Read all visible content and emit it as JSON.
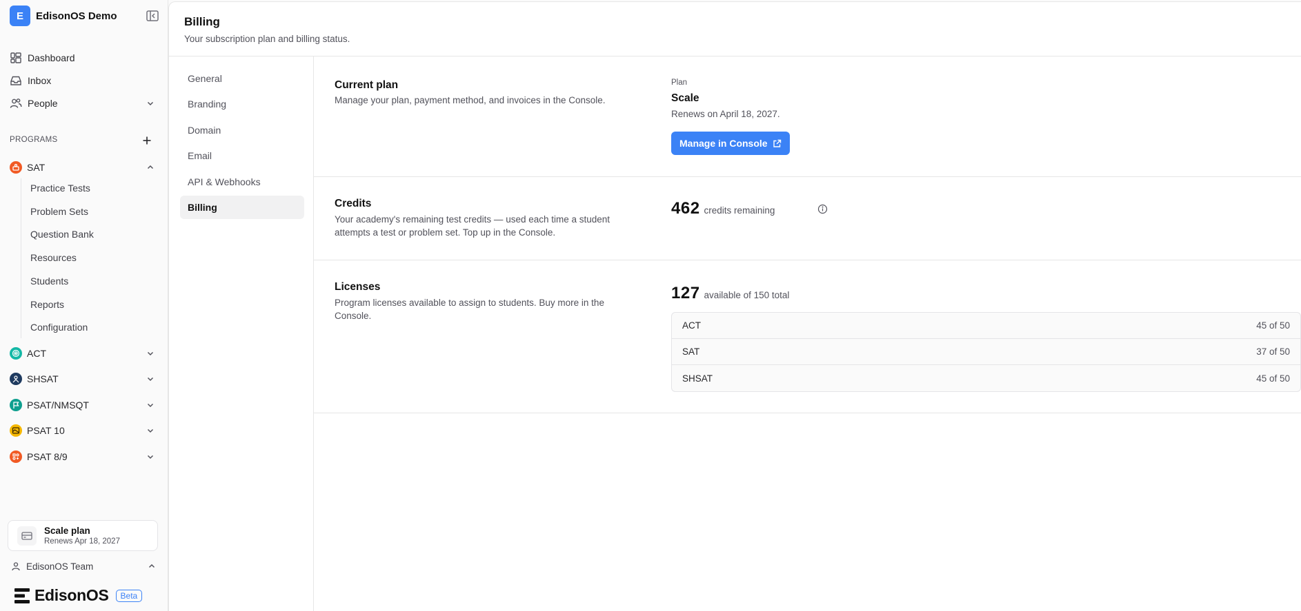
{
  "org": {
    "initial": "E",
    "name": "EdisonOS Demo"
  },
  "nav": {
    "dashboard": "Dashboard",
    "inbox": "Inbox",
    "people": "People"
  },
  "programs_label": "PROGRAMS",
  "programs": {
    "sat": "SAT",
    "sat_items": [
      "Practice Tests",
      "Problem Sets",
      "Question Bank",
      "Resources",
      "Students",
      "Reports",
      "Configuration"
    ],
    "act": "ACT",
    "shsat": "SHSAT",
    "psat_nmsqt": "PSAT/NMSQT",
    "psat10": "PSAT 10",
    "psat89": "PSAT 8/9"
  },
  "plan_card": {
    "title": "Scale plan",
    "subtitle": "Renews Apr 18, 2027"
  },
  "team": "EdisonOS Team",
  "brand": {
    "name": "EdisonOS",
    "badge": "Beta"
  },
  "header": {
    "title": "Billing",
    "subtitle": "Your subscription plan and billing status."
  },
  "settings_nav": [
    "General",
    "Branding",
    "Domain",
    "Email",
    "API & Webhooks",
    "Billing"
  ],
  "current_plan": {
    "title": "Current plan",
    "desc": "Manage your plan, payment method, and invoices in the Console.",
    "label": "Plan",
    "name": "Scale",
    "renews": "Renews on April 18, 2027.",
    "button": "Manage in Console"
  },
  "credits": {
    "title": "Credits",
    "desc": "Your academy's remaining test credits — used each time a student attempts a test or problem set. Top up in the Console.",
    "count": "462",
    "suffix": "credits remaining"
  },
  "licenses": {
    "title": "Licenses",
    "desc": "Program licenses available to assign to students. Buy more in the Console.",
    "count": "127",
    "suffix": "available of 150 total",
    "rows": [
      {
        "program": "ACT",
        "usage": "45 of 50"
      },
      {
        "program": "SAT",
        "usage": "37 of 50"
      },
      {
        "program": "SHSAT",
        "usage": "45 of 50"
      }
    ]
  },
  "colors": {
    "accent": "#3b82f6",
    "sat": "#f15a24",
    "act": "#14b8a6",
    "shsat": "#1e3a5f",
    "psat_nmsqt": "#0f9f8f",
    "psat10": "#f5b700",
    "psat89": "#f15a24"
  },
  "icons": [
    "sidebar-collapse-icon",
    "dashboard-icon",
    "inbox-icon",
    "people-icon",
    "chevron-down-icon",
    "chevron-up-icon",
    "plus-icon",
    "credit-card-icon",
    "user-icon",
    "external-link-icon",
    "info-icon",
    "edisonos-logo"
  ]
}
